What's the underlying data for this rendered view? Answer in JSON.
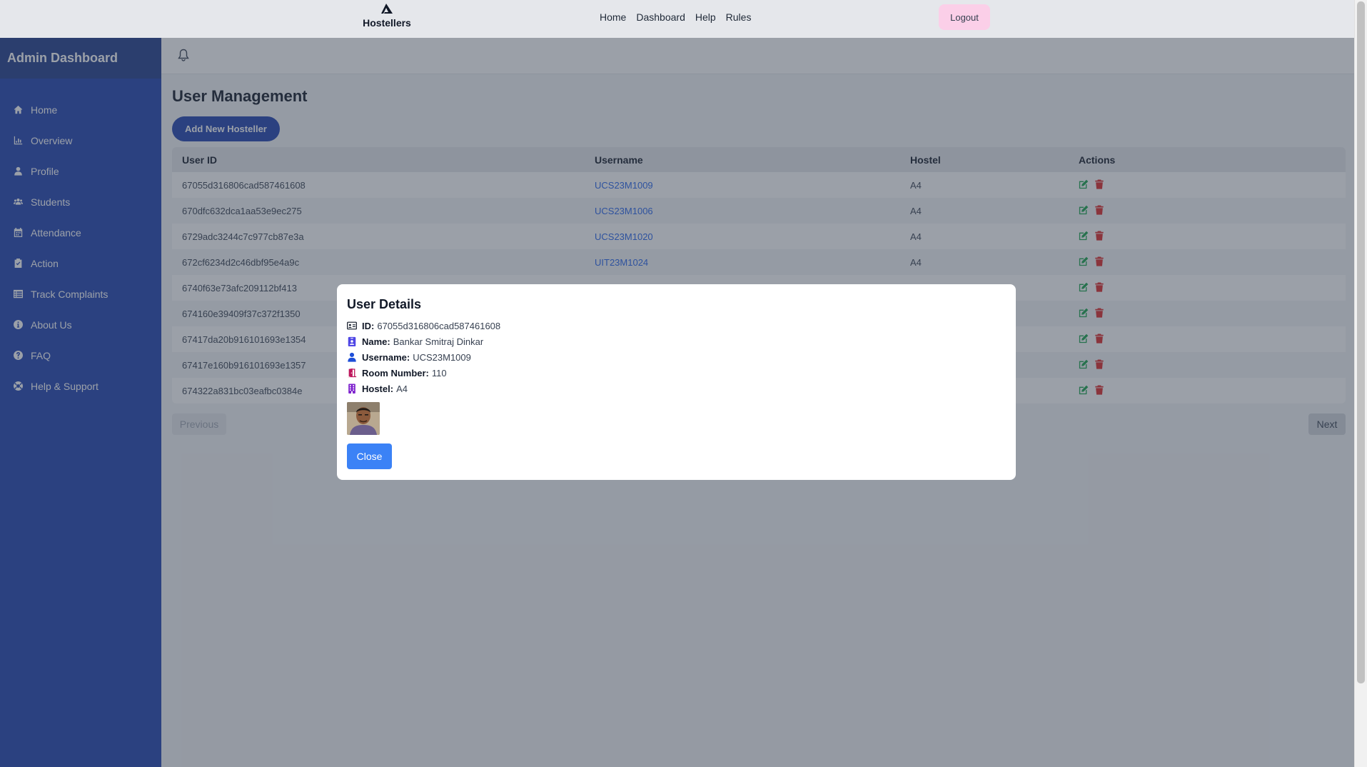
{
  "topnav": {
    "brand": "Hostellers",
    "links": [
      "Home",
      "Dashboard",
      "Help",
      "Rules"
    ],
    "logout": "Logout"
  },
  "sidebar": {
    "title": "Admin Dashboard",
    "items": [
      {
        "label": "Home",
        "icon": "home-icon"
      },
      {
        "label": "Overview",
        "icon": "chart-icon"
      },
      {
        "label": "Profile",
        "icon": "user-icon"
      },
      {
        "label": "Students",
        "icon": "users-icon"
      },
      {
        "label": "Attendance",
        "icon": "calendar-icon"
      },
      {
        "label": "Action",
        "icon": "clipboard-check-icon"
      },
      {
        "label": "Track Complaints",
        "icon": "list-icon"
      },
      {
        "label": "About Us",
        "icon": "info-icon"
      },
      {
        "label": "FAQ",
        "icon": "question-icon"
      },
      {
        "label": "Help & Support",
        "icon": "lifebuoy-icon"
      }
    ]
  },
  "main": {
    "title": "User Management",
    "add_button": "Add New Hosteller",
    "table": {
      "headers": [
        "User ID",
        "Username",
        "Hostel",
        "Actions"
      ],
      "rows": [
        {
          "id": "67055d316806cad587461608",
          "username": "UCS23M1009",
          "hostel": "A4"
        },
        {
          "id": "670dfc632dca1aa53e9ec275",
          "username": "UCS23M1006",
          "hostel": "A4"
        },
        {
          "id": "6729adc3244c7c977cb87e3a",
          "username": "UCS23M1020",
          "hostel": "A4"
        },
        {
          "id": "672cf6234d2c46dbf95e4a9c",
          "username": "UIT23M1024",
          "hostel": "A4"
        },
        {
          "id": "6740f63e73afc209112bf413",
          "username": "",
          "hostel": ""
        },
        {
          "id": "674160e39409f37c372f1350",
          "username": "",
          "hostel": ""
        },
        {
          "id": "67417da20b916101693e1354",
          "username": "",
          "hostel": ""
        },
        {
          "id": "67417e160b916101693e1357",
          "username": "",
          "hostel": ""
        },
        {
          "id": "674322a831bc03eafbc0384e",
          "username": "",
          "hostel": ""
        }
      ]
    },
    "prev": "Previous",
    "next": "Next"
  },
  "modal": {
    "title": "User Details",
    "fields": [
      {
        "label": "ID:",
        "value": "67055d316806cad587461608",
        "icon": "id-card-icon"
      },
      {
        "label": "Name:",
        "value": "Bankar Smitraj Dinkar",
        "icon": "id-badge-icon"
      },
      {
        "label": "Username:",
        "value": "UCS23M1009",
        "icon": "user-icon"
      },
      {
        "label": "Room Number:",
        "value": "110",
        "icon": "door-icon"
      },
      {
        "label": "Hostel:",
        "value": "A4",
        "icon": "building-icon"
      }
    ],
    "close": "Close"
  },
  "colors": {
    "sidebar": "#1e40af",
    "sidebar_header": "#1e3a8a",
    "link": "#2563eb",
    "edit": "#16a34a",
    "delete": "#dc2626",
    "close_button": "#3b82f6",
    "logout_bg": "#fbcfe8"
  }
}
